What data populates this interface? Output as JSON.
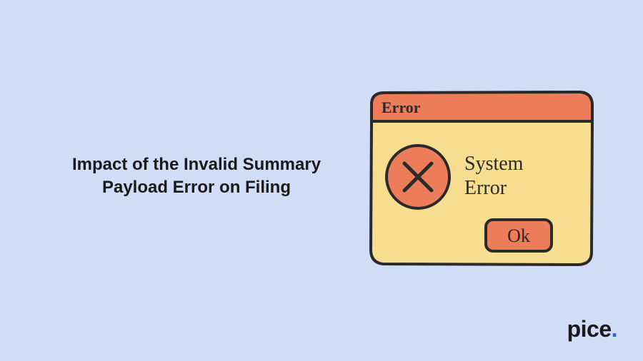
{
  "heading": {
    "line1": "Impact of the Invalid Summary",
    "line2": "Payload Error on Filing"
  },
  "dialog": {
    "title": "Error",
    "message_line1": "System",
    "message_line2": "Error",
    "button": "Ok"
  },
  "logo": {
    "text": "pice"
  }
}
